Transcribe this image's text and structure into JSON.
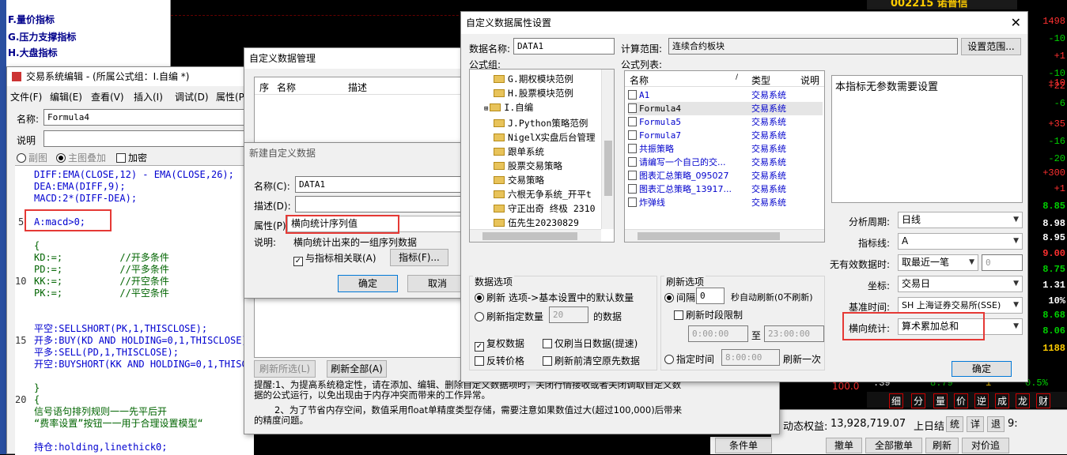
{
  "bg": {
    "menu_items": [
      "F.量价指标",
      "G.压力支撑指标",
      "H.大盘指标"
    ],
    "stock_header": "002215 诺普信",
    "right_numbers": [
      "1498",
      "-10",
      "+1",
      "-10",
      "+10",
      "+22",
      "-6",
      "+35",
      "-16",
      "-20",
      "+300",
      "+1",
      "8.85",
      "8.98",
      "8.95",
      "9.00",
      "8.75",
      "1.31",
      "10%",
      "8.68",
      "8.06",
      "1188"
    ],
    "bottom_row": [
      ":39",
      "8.79",
      "1",
      "0.5%"
    ],
    "bottom_value": "100.0",
    "tabs": [
      "细",
      "分",
      "量",
      "价",
      "逆",
      "成",
      "龙",
      "财"
    ],
    "equity_label": "动态权益:",
    "equity_value": "13,928,719.07",
    "last_day_label": "上日结",
    "mini_btns": [
      "统",
      "详",
      "退"
    ],
    "mini_val": "9:",
    "trade_btns": [
      "条件单",
      "撤单",
      "全部撤单",
      "刷新",
      "对价追"
    ]
  },
  "tse": {
    "title": "交易系统编辑 - (所属公式组：I.自编 *)",
    "menu": [
      "文件(F)",
      "编辑(E)",
      "查看(V)",
      "插入(I)",
      "调试(D)",
      "属性(P)"
    ],
    "name_label": "名称:",
    "name_value": "Formula4",
    "desc_label": "说明",
    "opt1": "副图",
    "opt2": "主图叠加",
    "opt3": "加密",
    "line_nums": [
      "5",
      "10",
      "15",
      "20"
    ],
    "code": [
      "DIFF:EMA(CLOSE,12) - EMA(CLOSE,26);",
      "DEA:EMA(DIFF,9);",
      "MACD:2*(DIFF-DEA);",
      "",
      "A:macd>0;",
      "",
      "{",
      "KD:=;          //开多条件",
      "PD:=;          //平多条件",
      "KK:=;          //开空条件",
      "PK:=;          //平空条件",
      "",
      "",
      "",
      "平空:SELLSHORT(PK,1,THISCLOSE);",
      "开多:BUY(KD AND HOLDING=0,1,THISCLOSE)",
      "平多:SELL(PD,1,THISCLOSE);",
      "开空:BUYSHORT(KK AND HOLDING=0,1,THISCL",
      "",
      "}",
      "{",
      "信号语句排列规则一一先平后开",
      "“费率设置”按钮一一用于合理设置模型“",
      "",
      "持仓:holding,linethick0;"
    ]
  },
  "cdm": {
    "title": "自定义数据管理",
    "cols": [
      "序",
      "名称",
      "描述"
    ],
    "btn_refresh_sel": "刷新所选(L)",
    "btn_refresh_all": "刷新全部(A)",
    "tip1": "提醒:1、为提高系统稳定性，请在添加、编辑、删除自定义数据项时，关闭行情接收或者关闭调取自定义数",
    "tip2": "据的公式运行，以免出现由于内存冲突而带来的工作异常。",
    "tip3": "2、为了节省内存空间，数值采用float单精度类型存储，需要注意如果数值过大(超过100,000)后带来",
    "tip4": "的精度问题。"
  },
  "ncd": {
    "title": "新建自定义数据",
    "name_label": "名称(C):",
    "name_value": "DATA1",
    "desc_label": "描述(D):",
    "attr_label": "属性(P):",
    "attr_value": "横向统计序列值",
    "note_label": "说明:",
    "note_value": "横向统计出来的一组序列数据",
    "link_label": "与指标相关联(A)",
    "indicator_btn": "指标(F)...",
    "ok": "确定",
    "cancel": "取消"
  },
  "cdp": {
    "title": "自定义数据属性设置",
    "name_label": "数据名称:",
    "name_value": "DATA1",
    "calc_label": "计算范围:",
    "calc_value": "连续合约板块",
    "set_range": "设置范围...",
    "group_label": "公式组:",
    "groups": [
      "G.期权模块范例",
      "H.股票模块范例",
      "I.自编",
      "J.Python策略范例",
      "NigelX实盘后台管理",
      "跟单系统",
      "股票交易策略",
      "交易策略",
      "六根无争系统_开平t",
      "守正出奇 终极 2310",
      "伍先生20230829"
    ],
    "list_label": "公式列表:",
    "list_cols": [
      "名称",
      "类型",
      "说明"
    ],
    "formulas": [
      {
        "name": "A1",
        "type": "交易系统"
      },
      {
        "name": "Formula4",
        "type": "交易系统"
      },
      {
        "name": "Formula5",
        "type": "交易系统"
      },
      {
        "name": "Formula7",
        "type": "交易系统"
      },
      {
        "name": "共振策略",
        "type": "交易系统"
      },
      {
        "name": "请编写一个自己的交...",
        "type": "交易系统"
      },
      {
        "name": "图表汇总策略_095027",
        "type": "交易系统"
      },
      {
        "name": "图表汇总策略_13917...",
        "type": "交易系统"
      },
      {
        "name": "炸弹线",
        "type": "交易系统"
      }
    ],
    "param_text": "本指标无参数需要设置",
    "period_label": "分析周期:",
    "period_value": "日线",
    "indline_label": "指标线:",
    "indline_value": "A",
    "invalid_label": "无有效数据时:",
    "invalid_value": "取最近一笔",
    "invalid_num": "0",
    "coord_label": "坐标:",
    "coord_value": "交易日",
    "basetime_label": "基准时间:",
    "basetime_value": "SH 上海证券交易所(SSE)",
    "hstat_label": "横向统计:",
    "hstat_value": "算术累加总和",
    "data_opts_title": "数据选项",
    "opt_refresh": "刷新 选项->基本设置中的默认数量",
    "opt_refresh_n": "刷新指定数量",
    "opt_n_value": "20",
    "opt_n_unit": "的数据",
    "chk_fq": "复权数据",
    "chk_today": "仅刷当日数据(提速)",
    "chk_reverse": "反转价格",
    "chk_clear": "刷新前清空原先数据",
    "refresh_title": "刷新选项",
    "interval_label": "间隔",
    "interval_value": "0",
    "interval_unit": "秒自动刷新(0不刷新)",
    "time_limit": "刷新时段限制",
    "t_from": "0:00:00",
    "t_to_label": "至",
    "t_to": "23:00:00",
    "fixed_label": "指定时间",
    "fixed_value": "8:00:00",
    "fixed_unit": "刷新一次",
    "ok": "确定"
  }
}
